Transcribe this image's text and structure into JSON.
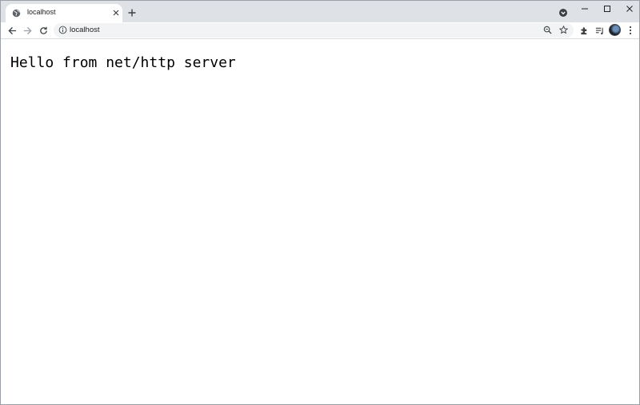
{
  "browser": {
    "tab": {
      "title": "localhost",
      "favicon": "globe-icon"
    },
    "address_bar": {
      "url": "localhost",
      "site_info_icon": "info-icon"
    },
    "toolbar_icons": [
      "back-arrow-icon",
      "forward-arrow-icon",
      "reload-icon",
      "zoom-icon",
      "star-icon",
      "extensions-puzzle-icon",
      "reading-list-icon",
      "avatar",
      "kebab-menu-icon"
    ],
    "window_controls": [
      "minimize-icon",
      "maximize-icon",
      "close-icon"
    ]
  },
  "page": {
    "body_text": "Hello from net/http server"
  },
  "colors": {
    "tabstrip": "#dee1e6",
    "omnibox": "#f1f3f4",
    "text": "#202124"
  }
}
